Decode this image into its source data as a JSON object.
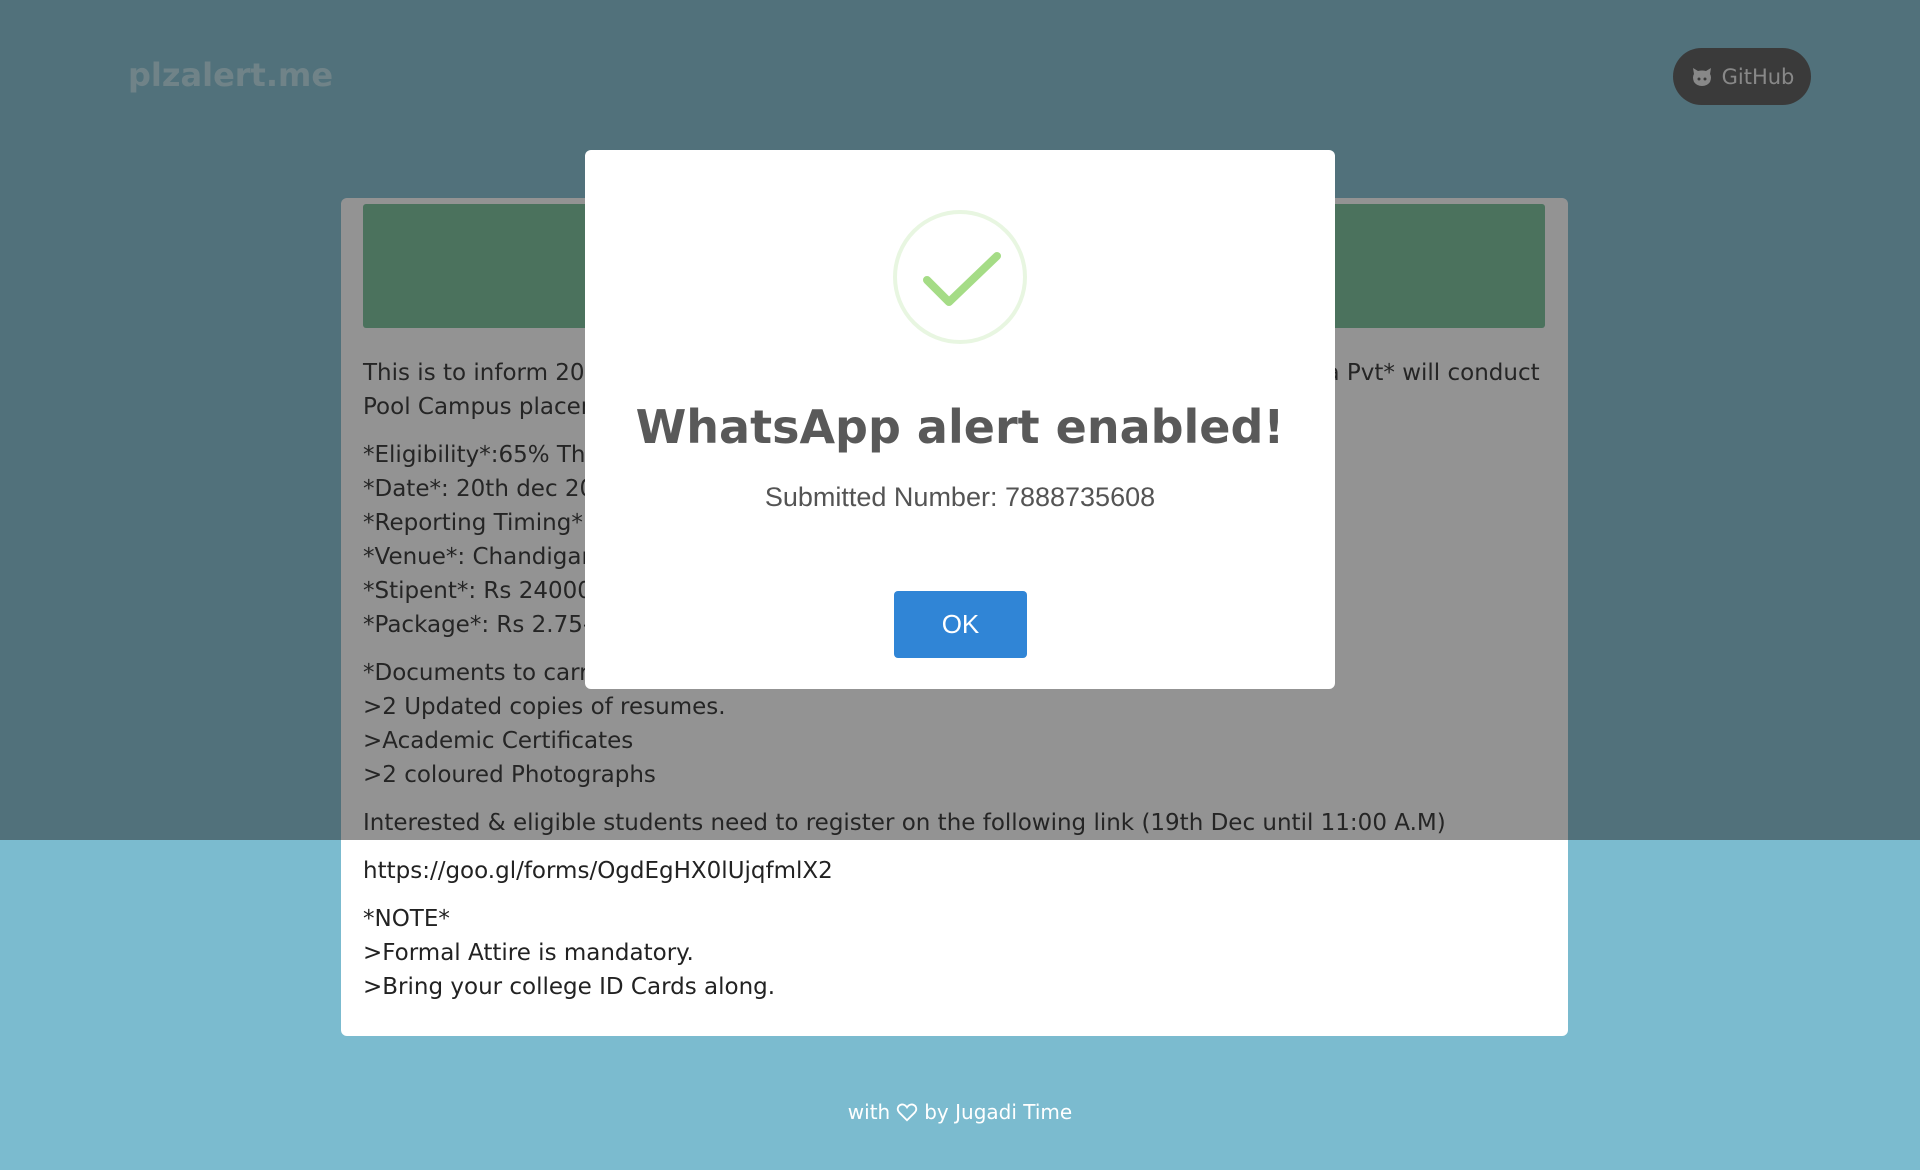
{
  "header": {
    "brand": "plzalert.me",
    "github_label": "GitHub"
  },
  "card": {
    "paragraphs": [
      "This is to inform 2018 batch students that *Intelligent Communication Systems India Pvt* will conduct Pool Campus placement drive.",
      "*Eligibility*:65% Throughout\n*Date*: 20th dec 2018\n*Reporting Timing*: 9:00 AM\n*Venue*: Chandigarh University\n*Stipent*: Rs 24000/- per month\n*Package*: Rs 2.75-3.5 LPA",
      "*Documents to carry*\n>2 Updated copies of resumes.\n>Academic Certificates\n>2 coloured Photographs",
      "Interested & eligible students need to register on the following link (19th Dec until 11:00 A.M)",
      "https://goo.gl/forms/OgdEgHX0lUjqfmlX2",
      "*NOTE*\n>Formal Attire is mandatory.\n>Bring your college ID Cards along."
    ]
  },
  "footer": {
    "with": "with",
    "by": "by Jugadi Time"
  },
  "modal": {
    "title": "WhatsApp alert enabled!",
    "text": "Submitted Number: 7888735608",
    "ok_label": "OK"
  },
  "colors": {
    "background": "#7bbbcf",
    "banner": "#6ebc93",
    "ok_button": "#3085d6",
    "check": "#a5dc86"
  }
}
